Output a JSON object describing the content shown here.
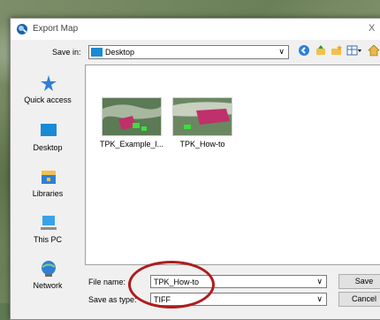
{
  "dialog": {
    "title": "Export Map",
    "close_glyph": "X"
  },
  "savein": {
    "label": "Save in:",
    "value": "Desktop",
    "arrow": "∨"
  },
  "toolbar": {
    "icons": [
      "back-icon",
      "up-folder-icon",
      "new-folder-icon",
      "view-menu-icon",
      "home-icon"
    ]
  },
  "places": [
    {
      "label": "Quick access",
      "icon": "pin-icon"
    },
    {
      "label": "Desktop",
      "icon": "desktop-icon"
    },
    {
      "label": "Libraries",
      "icon": "libraries-icon"
    },
    {
      "label": "This PC",
      "icon": "pc-icon"
    },
    {
      "label": "Network",
      "icon": "network-icon"
    }
  ],
  "files": [
    {
      "name": "TPK_Example_l..."
    },
    {
      "name": "TPK_How-to"
    }
  ],
  "filename": {
    "label": "File name:",
    "value": "TPK_How-to"
  },
  "savetype": {
    "label": "Save as type:",
    "value": "TIFF"
  },
  "buttons": {
    "save": "Save",
    "cancel": "Cancel"
  },
  "colors": {
    "folder_blue": "#1a8ad4",
    "highlight_circle": "#b01c1c"
  }
}
